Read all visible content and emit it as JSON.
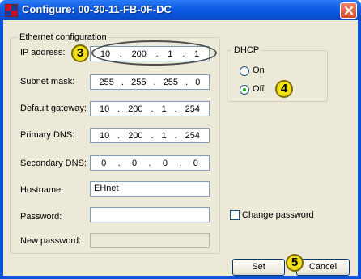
{
  "window": {
    "title": "Configure: 00-30-11-FB-0F-DC"
  },
  "ethernet_group": {
    "label": "Ethernet configuration",
    "ip_address": {
      "label": "IP address:",
      "octets": [
        "10",
        "200",
        "1",
        "1"
      ]
    },
    "subnet_mask": {
      "label": "Subnet mask:",
      "octets": [
        "255",
        "255",
        "255",
        "0"
      ]
    },
    "default_gateway": {
      "label": "Default gateway:",
      "octets": [
        "10",
        "200",
        "1",
        "254"
      ]
    },
    "primary_dns": {
      "label": "Primary DNS:",
      "octets": [
        "10",
        "200",
        "1",
        "254"
      ]
    },
    "secondary_dns": {
      "label": "Secondary DNS:",
      "octets": [
        "0",
        "0",
        "0",
        "0"
      ]
    },
    "hostname": {
      "label": "Hostname:",
      "value": "EHnet"
    },
    "password": {
      "label": "Password:",
      "value": ""
    },
    "new_password": {
      "label": "New password:",
      "value": ""
    }
  },
  "dhcp": {
    "label": "DHCP",
    "on_label": "On",
    "off_label": "Off",
    "selected": "Off"
  },
  "change_password": {
    "label": "Change password",
    "checked": false
  },
  "buttons": {
    "set": "Set",
    "cancel": "Cancel"
  },
  "annotations": {
    "marker_3": "3",
    "marker_4": "4",
    "marker_5": "5"
  },
  "colors": {
    "titlebar": "#0c5ce3",
    "dialog_bg": "#ece9d8",
    "marker": "#f2e01a"
  }
}
